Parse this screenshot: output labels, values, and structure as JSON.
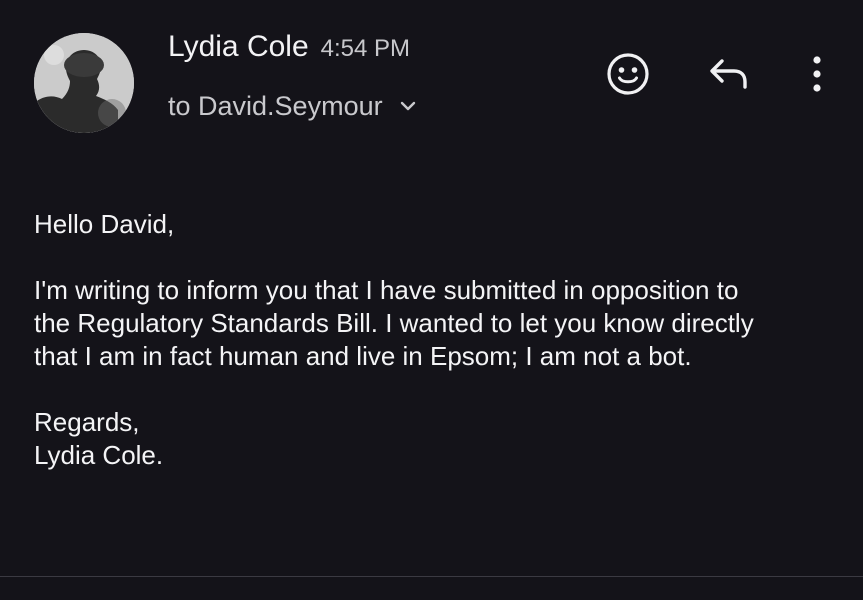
{
  "message": {
    "sender_name": "Lydia Cole",
    "time": "4:54 PM",
    "recipient": "to David.Seymour",
    "greeting": "Hello David,",
    "body_lines": [
      "I'm writing to inform you that I have submitted in opposition to",
      "the Regulatory Standards Bill. I wanted to let you know directly",
      "that I am in fact human and live in Epsom; I am not a bot."
    ],
    "signoff": "Regards,",
    "signature": "Lydia Cole."
  },
  "icons": {
    "avatar": "sender-avatar",
    "expand": "chevron-down-icon",
    "react": "emoji-smile-icon",
    "reply": "reply-arrow-icon",
    "more": "more-vertical-icon"
  },
  "colors": {
    "background": "#141319",
    "text": "#f1f1f3",
    "muted": "#c9c9cd"
  }
}
